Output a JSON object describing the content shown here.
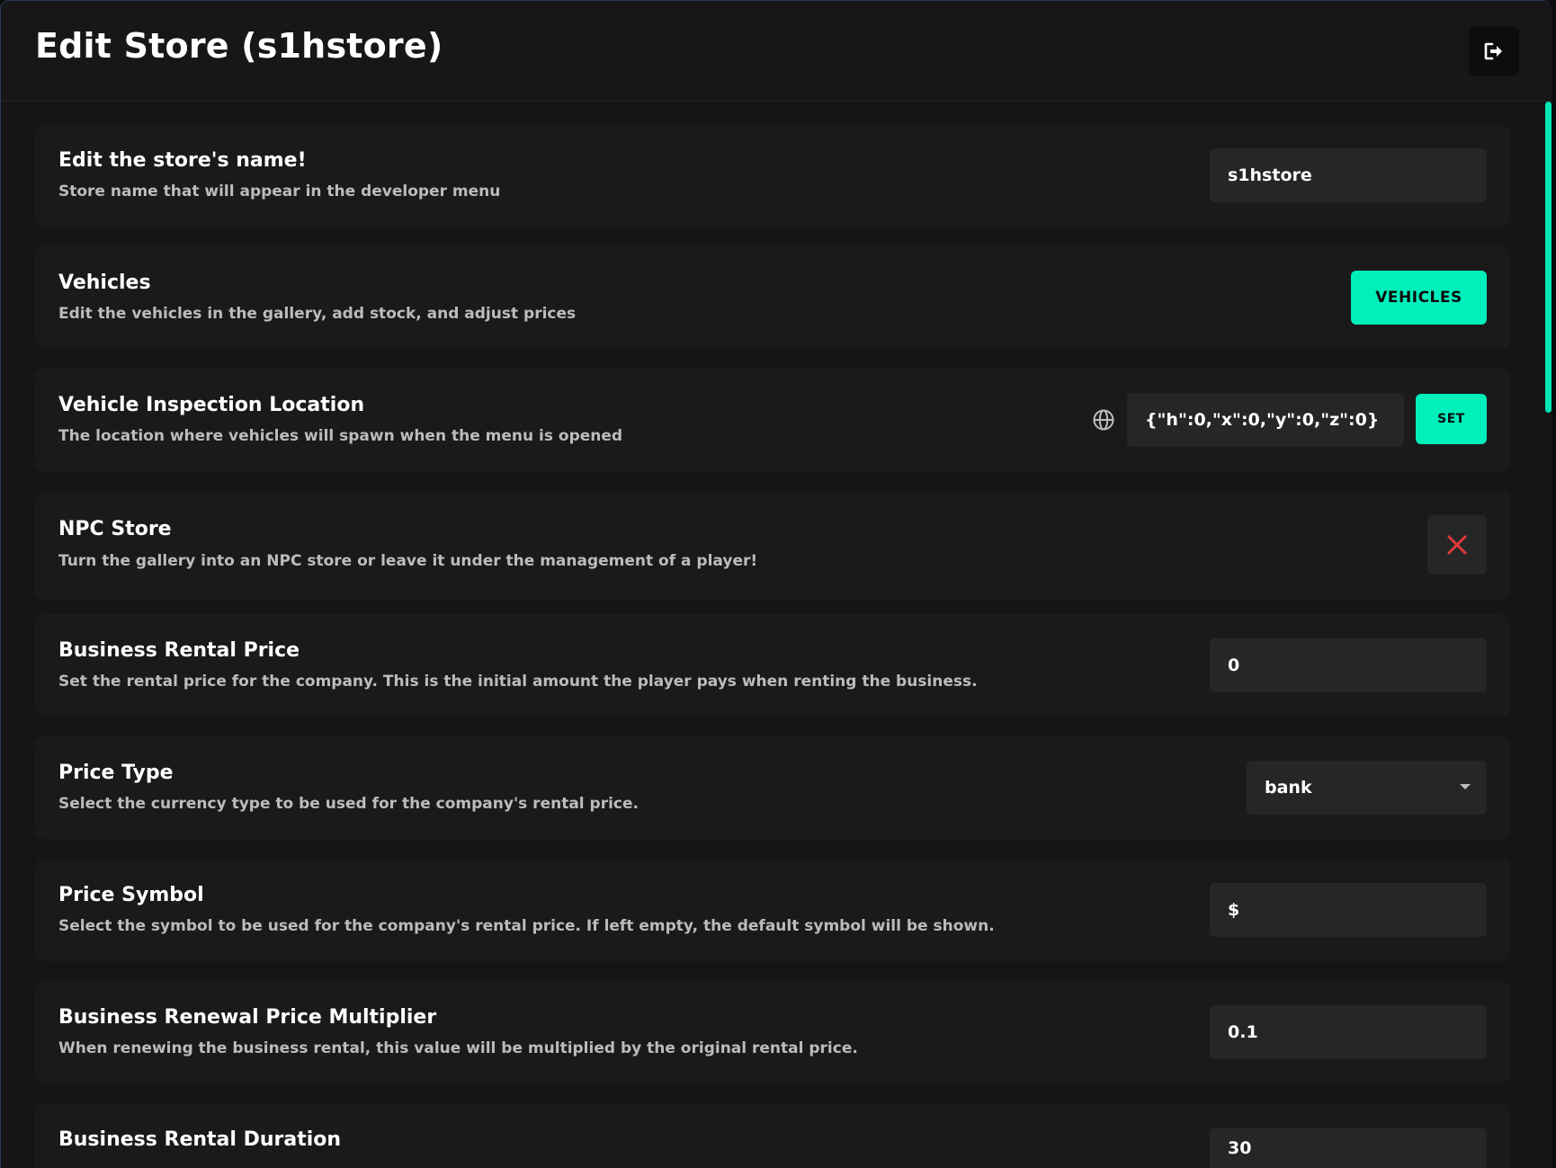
{
  "header": {
    "title": "Edit Store (s1hstore)",
    "exit_icon": "sign-out-icon"
  },
  "rows": {
    "store_name": {
      "title": "Edit the store's name!",
      "desc": "Store name that will appear in the developer menu",
      "value": "s1hstore"
    },
    "vehicles": {
      "title": "Vehicles",
      "desc": "Edit the vehicles in the gallery, add stock, and adjust prices",
      "button": "VEHICLES"
    },
    "inspection": {
      "title": "Vehicle Inspection Location",
      "desc": "The location where vehicles will spawn when the menu is opened",
      "value": "{\"h\":0,\"x\":0,\"y\":0,\"z\":0}",
      "button": "SET",
      "icon": "globe-icon"
    },
    "npc_store": {
      "title": "NPC Store",
      "desc": "Turn the gallery into an NPC store or leave it under the management of a player!",
      "icon": "close-icon",
      "icon_color": "#e03a3a"
    },
    "rental_price": {
      "title": "Business Rental Price",
      "desc": "Set the rental price for the company. This is the initial amount the player pays when renting the business.",
      "value": "0"
    },
    "price_type": {
      "title": "Price Type",
      "desc": "Select the currency type to be used for the company's rental price.",
      "value": "bank"
    },
    "price_symbol": {
      "title": "Price Symbol",
      "desc": "Select the symbol to be used for the company's rental price. If left empty, the default symbol will be shown.",
      "value": "$"
    },
    "renewal_multiplier": {
      "title": "Business Renewal Price Multiplier",
      "desc": "When renewing the business rental, this value will be multiplied by the original rental price.",
      "value": "0.1"
    },
    "rental_duration": {
      "title": "Business Rental Duration",
      "value": "30"
    }
  },
  "theme": {
    "accent": "#00f0bc",
    "background": "#151516",
    "card": "#1a1a1b",
    "field": "#262627"
  }
}
